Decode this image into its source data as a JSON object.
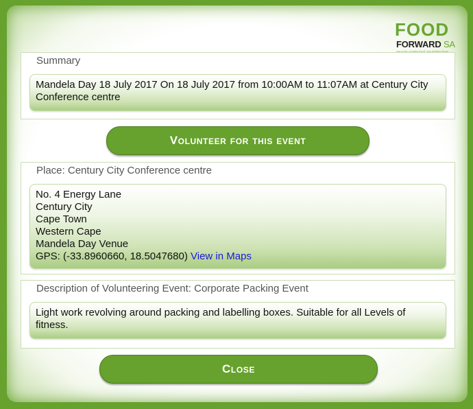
{
  "logo": {
    "word_food": "FOOD",
    "word_forward": "FORWARD",
    "word_sa": "SA",
    "tagline": "Securing quality food. Nourishing lives."
  },
  "summary": {
    "title": "Summary",
    "text": "Mandela Day 18 July 2017 On 18 July 2017 from 10:00AM to 11:07AM at Century City Conference centre"
  },
  "volunteer_button": {
    "label": "Volunteer for this event"
  },
  "place": {
    "title": "Place: Century City Conference centre",
    "lines": [
      "No. 4 Energy Lane",
      "Century City",
      "Cape Town",
      "Western Cape",
      "Mandela Day Venue"
    ],
    "gps_prefix": "GPS: (-33.8960660, 18.5047680)",
    "maps_link": "View in Maps"
  },
  "description": {
    "title": "Description of Volunteering Event: Corporate Packing Event",
    "text": "Light work revolving around packing and labelling boxes. Suitable for all Levels of fitness."
  },
  "close_button": {
    "label": "Close"
  },
  "colors": {
    "brand_green": "#66a22d",
    "link_blue": "#1a1adb"
  }
}
